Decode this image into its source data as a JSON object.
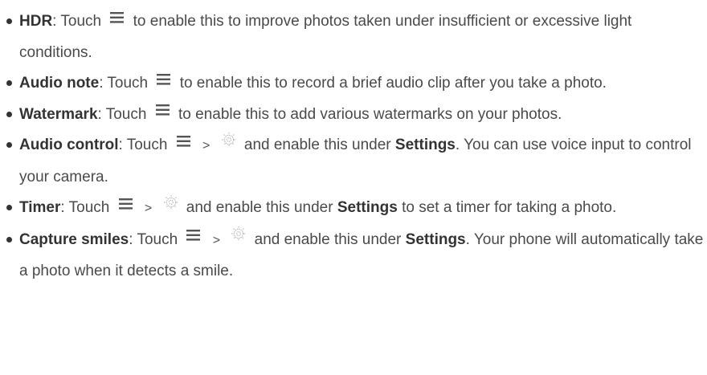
{
  "items": [
    {
      "term": "HDR",
      "after_term": ": Touch",
      "text": "to enable this to improve photos taken under insufficient or excessive light conditions."
    },
    {
      "term": "Audio note",
      "after_term": ": Touch",
      "text": "to enable this to record a brief audio clip after you take a photo."
    },
    {
      "term": "Watermark",
      "after_term": ": Touch",
      "text": "to enable this to add various watermarks on your photos."
    },
    {
      "term": "Audio control",
      "after_term": ": Touch",
      "separator": ">",
      "text_before_bold": "and enable this under",
      "bold": "Settings",
      "text_after_bold": ". You can use voice input to control your camera."
    },
    {
      "term": "Timer",
      "after_term": ": Touch",
      "separator": ">",
      "text_before_bold": "and enable this under",
      "bold": "Settings",
      "text_after_bold": "to set a timer for taking a photo."
    },
    {
      "term": "Capture smiles",
      "after_term": ": Touch",
      "separator": ">",
      "text_before_bold": "and enable this under",
      "bold": "Settings",
      "text_after_bold": ". Your phone will automatically take a photo when it detects a smile."
    }
  ],
  "icons": {
    "menu": "menu-icon",
    "settings": "gear-icon"
  }
}
